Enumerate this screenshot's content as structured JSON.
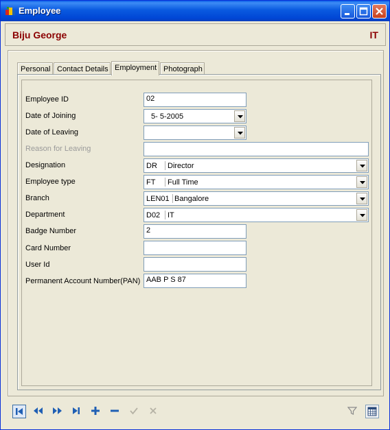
{
  "window": {
    "title": "Employee"
  },
  "header": {
    "employee_name": "Biju George",
    "department_code": "IT"
  },
  "tabs": [
    {
      "label": "Personal",
      "active": false
    },
    {
      "label": "Contact Details",
      "active": false
    },
    {
      "label": "Employment",
      "active": true
    },
    {
      "label": "Photograph",
      "active": false
    }
  ],
  "form": {
    "employee_id": {
      "label": "Employee ID",
      "value": "02"
    },
    "date_of_joining": {
      "label": "Date of Joining",
      "value": "5- 5-2005"
    },
    "date_of_leaving": {
      "label": "Date of Leaving",
      "value": ""
    },
    "reason_for_leaving": {
      "label": "Reason for Leaving",
      "value": ""
    },
    "designation": {
      "label": "Designation",
      "code": "DR",
      "value": "Director"
    },
    "employee_type": {
      "label": "Employee type",
      "code": "FT",
      "value": "Full Time"
    },
    "branch": {
      "label": "Branch",
      "code": "LEN01",
      "value": "Bangalore"
    },
    "department": {
      "label": "Department",
      "code": "D02",
      "value": "IT"
    },
    "badge_number": {
      "label": "Badge Number",
      "value": "2"
    },
    "card_number": {
      "label": "Card Number",
      "value": ""
    },
    "user_id": {
      "label": "User Id",
      "value": ""
    },
    "pan": {
      "label": "Permanent Account Number(PAN)",
      "value": "AAB P S 87"
    }
  },
  "toolbar": {
    "icons": [
      "first-record-icon",
      "prior-record-icon",
      "next-record-icon",
      "last-record-icon",
      "add-record-icon",
      "delete-record-icon",
      "post-edit-icon",
      "cancel-edit-icon",
      "filter-icon",
      "calendar-icon"
    ]
  },
  "colors": {
    "titlebar": "#0a5ae0",
    "accent_text": "#8b0000",
    "nav_icon": "#1f5fb4"
  }
}
